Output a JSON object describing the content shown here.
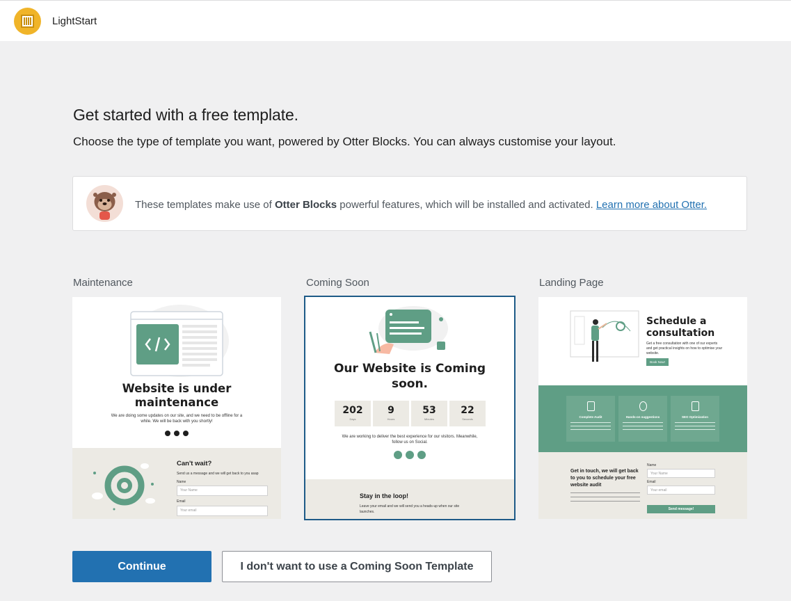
{
  "app": {
    "name": "LightStart"
  },
  "header": {
    "title": "Get started with a free template.",
    "subtitle": "Choose the type of template you want, powered by Otter Blocks. You can always customise your layout."
  },
  "notice": {
    "text_before": "These templates make use of ",
    "bold": "Otter Blocks",
    "text_after": " powerful features, which will be installed and activated. ",
    "link": "Learn more about Otter."
  },
  "templates": [
    {
      "label": "Maintenance",
      "selected": false,
      "preview": {
        "title": "Website is under maintenance",
        "text": "We are doing some updates on our site, and we need to be offline for a while. We will be back with you shortly!",
        "cta_title": "Can't wait?",
        "cta_text": "Send us a message and we will get back to you asap",
        "name_label": "Name",
        "name_placeholder": "Your Name",
        "email_label": "Email",
        "email_placeholder": "Your email"
      }
    },
    {
      "label": "Coming Soon",
      "selected": true,
      "preview": {
        "title": "Our Website is Coming soon.",
        "countdown": [
          {
            "value": "202",
            "unit": "Days"
          },
          {
            "value": "9",
            "unit": "Hours"
          },
          {
            "value": "53",
            "unit": "Minutes"
          },
          {
            "value": "22",
            "unit": "Seconds"
          }
        ],
        "text": "We are working to deliver the best experience for our visitors. Meanwhile, follow us on Social.",
        "footer_title": "Stay in the loop!",
        "footer_text": "Leave your email and we will send you a heads-up when our site launches."
      }
    },
    {
      "label": "Landing Page",
      "selected": false,
      "preview": {
        "title": "Schedule a consultation",
        "text": "Get a free consultation with one of our experts and get practical insights on how to optimise your website.",
        "button": "Book Now!",
        "features": [
          "Complete Audit",
          "Hands-on suggestions",
          "SEO Optimization"
        ],
        "contact_title": "Get in touch, we will get back to you to schedule your free website audit",
        "name_label": "Name",
        "name_placeholder": "Your Name",
        "email_label": "Email",
        "email_placeholder": "Your email",
        "submit": "Send message!"
      }
    }
  ],
  "actions": {
    "continue": "Continue",
    "skip": "I don't want to use a Coming Soon Template"
  },
  "colors": {
    "primary": "#2271b1",
    "accent_green": "#5f9e85",
    "logo": "#f0b429",
    "background": "#f0f0f1"
  }
}
